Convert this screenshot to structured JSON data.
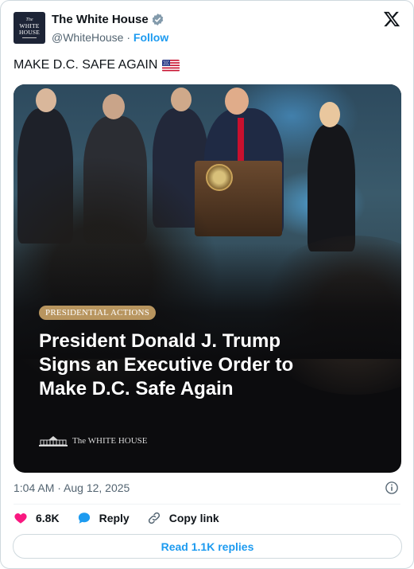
{
  "author": {
    "avatar_text": [
      "The",
      "WHITE",
      "HOUSE"
    ],
    "display_name": "The White House",
    "handle": "@WhiteHouse",
    "separator": " · ",
    "follow_label": "Follow",
    "verified_color": "#829aab"
  },
  "tweet": {
    "text": "MAKE D.C. SAFE AGAIN",
    "emoji": "flag-us",
    "timestamp": "1:04 AM · Aug 12, 2025"
  },
  "media": {
    "tag": "PRESIDENTIAL ACTIONS",
    "headline_lines": [
      "President Donald J. Trump",
      "Signs an Executive Order to",
      "Make D.C. Safe Again"
    ],
    "logo_text": "The WHITE HOUSE"
  },
  "actions": {
    "like_count": "6.8K",
    "reply_label": "Reply",
    "copy_label": "Copy link",
    "read_replies_label": "Read 1.1K replies"
  },
  "colors": {
    "accent": "#1d9bf0",
    "like": "#f91880",
    "tag_gold": "#b8955f"
  }
}
